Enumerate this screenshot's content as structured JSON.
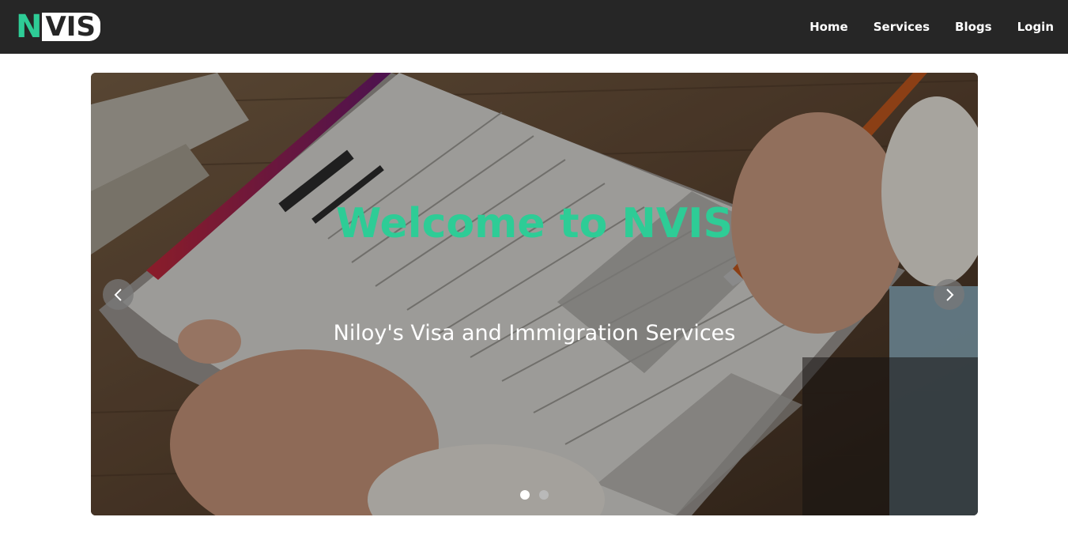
{
  "brand": {
    "letter": "N",
    "rest": "VIS"
  },
  "nav": {
    "items": [
      {
        "label": "Home"
      },
      {
        "label": "Services"
      },
      {
        "label": "Blogs"
      },
      {
        "label": "Login"
      }
    ]
  },
  "hero": {
    "title": "Welcome to NVIS",
    "subtitle": "Niloy's Visa and Immigration Services",
    "slide_count": 2,
    "active_slide": 1
  },
  "colors": {
    "accent": "#2ecc96",
    "navbar": "#262626"
  },
  "icons": {
    "prev": "chevron-left-icon",
    "next": "chevron-right-icon"
  }
}
